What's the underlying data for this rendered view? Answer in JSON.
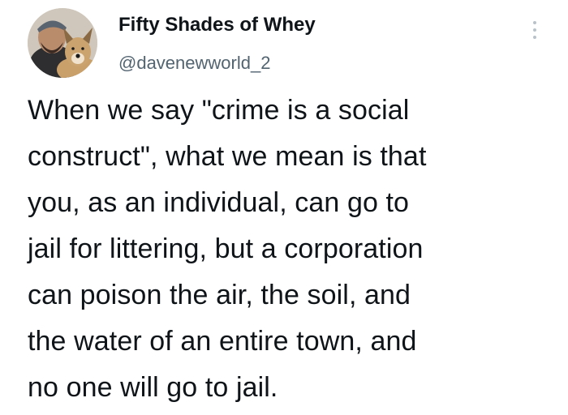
{
  "author": {
    "display_name": "Fifty Shades of Whey",
    "handle": "@davenewworld_2",
    "avatar_icon": "profile-photo-man-with-dog"
  },
  "more_icon": "vertical-ellipsis-icon",
  "tweet": {
    "lines": [
      "When we say \"crime is a social",
      "construct\", what we mean is that",
      "you, as an individual, can go to",
      "jail for littering, but a corporation",
      "can poison the air, the soil, and",
      "the water of an entire town, and",
      "no one will go to jail."
    ]
  },
  "colors": {
    "text": "#0f1419",
    "secondary": "#536471",
    "background": "#ffffff"
  }
}
